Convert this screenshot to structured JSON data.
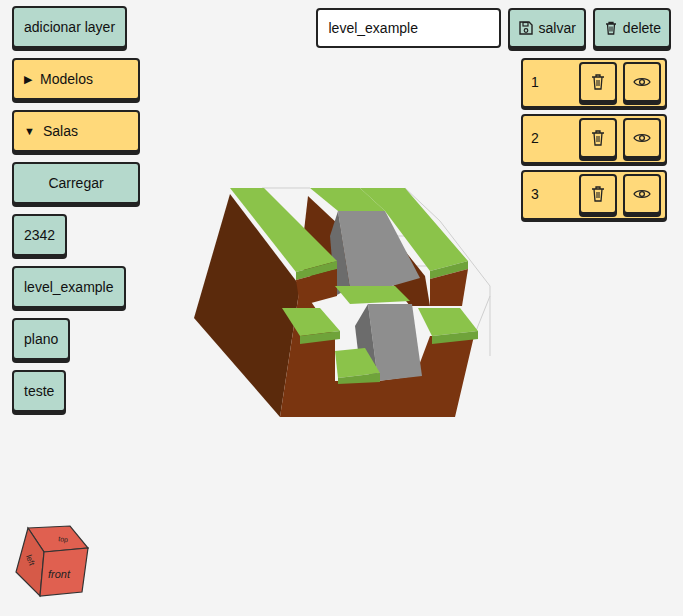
{
  "toolbar": {
    "add_layer": "adicionar layer",
    "level_name": "level_example",
    "save": "salvar",
    "delete": "delete"
  },
  "sections": [
    {
      "icon": "▶",
      "label": "Modelos",
      "expanded": false,
      "load_button": "",
      "rooms": []
    },
    {
      "icon": "▼",
      "label": "Salas",
      "expanded": true,
      "load_button": "Carregar",
      "rooms": [
        "2342",
        "level_example",
        "plano",
        "teste"
      ]
    }
  ],
  "layers": [
    {
      "label": "1"
    },
    {
      "label": "2"
    },
    {
      "label": "3"
    }
  ],
  "orientation_cube": {
    "top": "top",
    "left": "left",
    "front": "front"
  }
}
